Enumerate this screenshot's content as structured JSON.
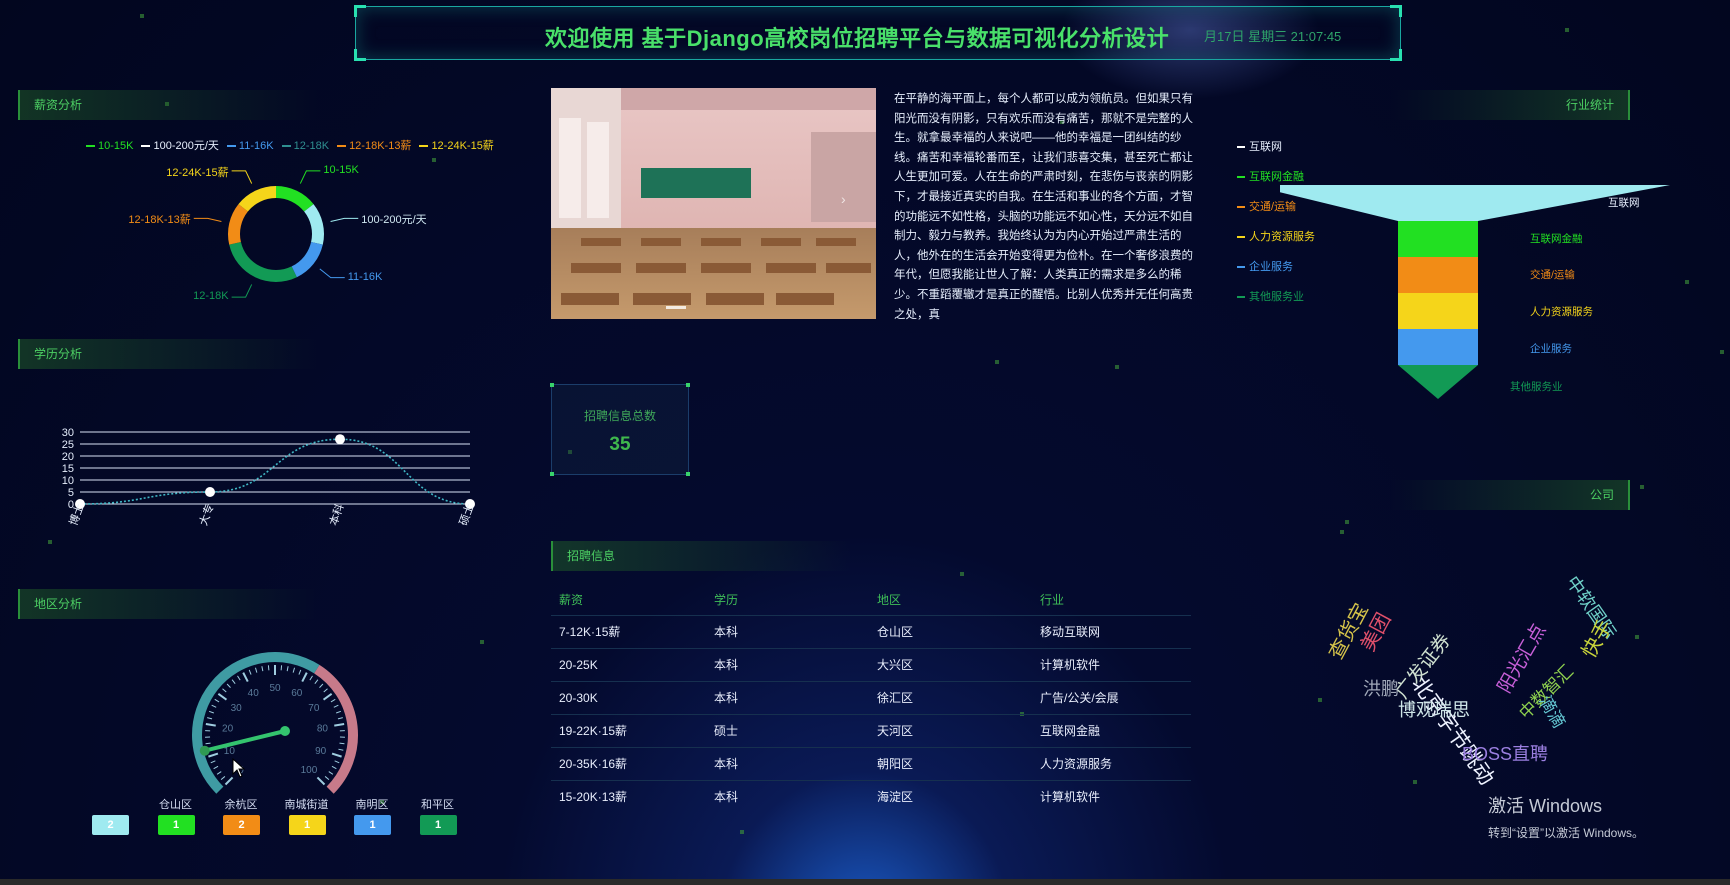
{
  "header": {
    "title": "欢迎使用 基于Django高校岗位招聘平台与数据可视化分析设计",
    "datetime": "月17日 星期三 21:07:45"
  },
  "sections": {
    "salary": "薪资分析",
    "education": "学历分析",
    "region": "地区分析",
    "industry": "行业统计",
    "company": "公司",
    "jobs": "招聘信息"
  },
  "colors": {
    "green": "#22e022",
    "white": "#ffffff",
    "lightblue": "#9feaf0",
    "blue": "#4499ee",
    "orange": "#f28c16",
    "yellow": "#f5d51a",
    "darkgreen": "#129a55",
    "teal": "#2f8f90"
  },
  "salary_chart": {
    "type": "pie",
    "legend": [
      {
        "label": "10-15K",
        "color": "#22e022"
      },
      {
        "label": "100-200元/天",
        "color": "#ffffff"
      },
      {
        "label": "11-16K",
        "color": "#4499ee"
      },
      {
        "label": "12-18K",
        "color": "#2f8f90"
      },
      {
        "label": "12-18K-13薪",
        "color": "#f28c16"
      },
      {
        "label": "12-24K-15薪",
        "color": "#f5d51a"
      }
    ],
    "slices": [
      {
        "label": "10-15K",
        "value": 1,
        "color": "#22e022"
      },
      {
        "label": "100-200元/天",
        "value": 1,
        "color": "#9feaf0"
      },
      {
        "label": "11-16K",
        "value": 1,
        "color": "#4499ee"
      },
      {
        "label": "12-18K",
        "value": 2,
        "color": "#129a55"
      },
      {
        "label": "12-18K-13薪",
        "value": 1,
        "color": "#f28c16"
      },
      {
        "label": "12-24K-15薪",
        "value": 1,
        "color": "#f5d51a"
      }
    ]
  },
  "education_chart": {
    "type": "line",
    "categories": [
      "博士",
      "大专",
      "本科",
      "硕士"
    ],
    "values": [
      0,
      5,
      27,
      0
    ],
    "y_ticks": [
      "0",
      "5",
      "10",
      "15",
      "20",
      "25",
      "30"
    ],
    "ylim": [
      0,
      30
    ]
  },
  "region_gauge": {
    "ticks": [
      "0",
      "10",
      "20",
      "30",
      "40",
      "50",
      "60",
      "70",
      "80",
      "90",
      "100"
    ],
    "value": 12,
    "regions": [
      {
        "label": "",
        "count": "2",
        "color": "#9feaf0"
      },
      {
        "label": "仓山区",
        "count": "1",
        "color": "#22e022"
      },
      {
        "label": "余杭区",
        "count": "2",
        "color": "#f28c16"
      },
      {
        "label": "南城街道",
        "count": "1",
        "color": "#f5d51a"
      },
      {
        "label": "南明区",
        "count": "1",
        "color": "#4499ee"
      },
      {
        "label": "和平区",
        "count": "1",
        "color": "#129a55"
      }
    ]
  },
  "article": {
    "text": "在平静的海平面上，每个人都可以成为领航员。但如果只有阳光而没有阴影，只有欢乐而没有痛苦，那就不是完整的人生。就拿最幸福的人来说吧——他的幸福是一团纠结的纱线。痛苦和幸福轮番而至，让我们悲喜交集，甚至死亡都让人生更加可爱。人在生命的严肃时刻，在悲伤与丧亲的阴影下，才最接近真实的自我。在生活和事业的各个方面，才智的功能远不如性格，头脑的功能远不如心性，天分远不如自制力、毅力与教养。我始终认为为内心开始过严肃生活的人，他外在的生活会开始变得更为俭朴。在一个奢侈浪费的年代，但愿我能让世人了解：人类真正的需求是多么的稀少。不重蹈覆辙才是真正的醒悟。比别人优秀并无任何高贵之处，真"
  },
  "stats": {
    "label": "招聘信息总数",
    "value": "35"
  },
  "jobs_table": {
    "headers": [
      "薪资",
      "学历",
      "地区",
      "行业"
    ],
    "rows": [
      [
        "7-12K·15薪",
        "本科",
        "仓山区",
        "移动互联网"
      ],
      [
        "20-25K",
        "本科",
        "大兴区",
        "计算机软件"
      ],
      [
        "20-30K",
        "本科",
        "徐汇区",
        "广告/公关/会展"
      ],
      [
        "19-22K·15薪",
        "硕士",
        "天河区",
        "互联网金融"
      ],
      [
        "20-35K·16薪",
        "本科",
        "朝阳区",
        "人力资源服务"
      ],
      [
        "15-20K·13薪",
        "本科",
        "海淀区",
        "计算机软件"
      ]
    ]
  },
  "industry_funnel": {
    "type": "funnel",
    "legend": [
      {
        "label": "互联网",
        "color": "#ffffff"
      },
      {
        "label": "互联网金融",
        "color": "#22e022"
      },
      {
        "label": "交通/运输",
        "color": "#f28c16"
      },
      {
        "label": "人力资源服务",
        "color": "#f5d51a"
      },
      {
        "label": "企业服务",
        "color": "#4499ee"
      },
      {
        "label": "其他服务业",
        "color": "#129a55"
      }
    ],
    "stages": [
      {
        "label": "互联网",
        "color": "#9feaf0"
      },
      {
        "label": "互联网金融",
        "color": "#22e022"
      },
      {
        "label": "交通/运输",
        "color": "#f28c16"
      },
      {
        "label": "人力资源服务",
        "color": "#f5d51a"
      },
      {
        "label": "企业服务",
        "color": "#4499ee"
      },
      {
        "label": "其他服务业",
        "color": "#129a55"
      }
    ]
  },
  "company_cloud": {
    "words": [
      {
        "text": "查货宝",
        "color": "#d4c24a"
      },
      {
        "text": "美团",
        "color": "#e0506a"
      },
      {
        "text": "广发证券",
        "color": "#cfe0d0"
      },
      {
        "text": "洪鹏",
        "color": "#a0a8b8"
      },
      {
        "text": "北京字节跳动",
        "color": "#eef2ff"
      },
      {
        "text": "博观瑞思",
        "color": "#cfe6e8"
      },
      {
        "text": "阳光汇点",
        "color": "#c85fd8"
      },
      {
        "text": "中数智汇",
        "color": "#8fd14f"
      },
      {
        "text": "中软国际",
        "color": "#6fd0c8"
      },
      {
        "text": "快手",
        "color": "#c8d33a"
      },
      {
        "text": "滴滴",
        "color": "#64c8d4"
      },
      {
        "text": "BOSS直聘",
        "color": "#9b7fe0"
      }
    ]
  },
  "watermark": {
    "line1": "激活 Windows",
    "line2": "转到“设置”以激活 Windows。"
  }
}
